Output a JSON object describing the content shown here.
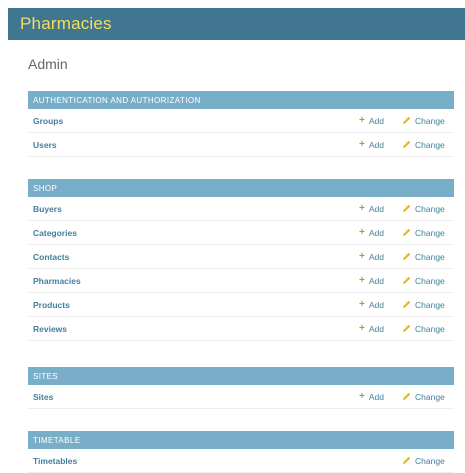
{
  "header": {
    "site_name": "Pharmacies"
  },
  "page_title": "Admin",
  "action_labels": {
    "add": "Add",
    "change": "Change"
  },
  "colors": {
    "header_bg": "#417690",
    "site_name": "#f5dd5d",
    "caption_bg": "#79aec8",
    "link": "#447e9b",
    "add_icon": "#70bf2b",
    "change_icon": "#efb80b"
  },
  "icons": {
    "add": "plus-icon",
    "change": "pencil-icon"
  },
  "apps": [
    {
      "caption": "Authentication and Authorization",
      "models": [
        {
          "name": "Groups",
          "add": true,
          "change": true
        },
        {
          "name": "Users",
          "add": true,
          "change": true
        }
      ]
    },
    {
      "caption": "Shop",
      "models": [
        {
          "name": "Buyers",
          "add": true,
          "change": true
        },
        {
          "name": "Categories",
          "add": true,
          "change": true
        },
        {
          "name": "Contacts",
          "add": true,
          "change": true
        },
        {
          "name": "Pharmacies",
          "add": true,
          "change": true
        },
        {
          "name": "Products",
          "add": true,
          "change": true
        },
        {
          "name": "Reviews",
          "add": true,
          "change": true
        }
      ]
    },
    {
      "caption": "Sites",
      "models": [
        {
          "name": "Sites",
          "add": true,
          "change": true
        }
      ]
    },
    {
      "caption": "Timetable",
      "models": [
        {
          "name": "Timetables",
          "add": false,
          "change": true
        }
      ]
    }
  ]
}
